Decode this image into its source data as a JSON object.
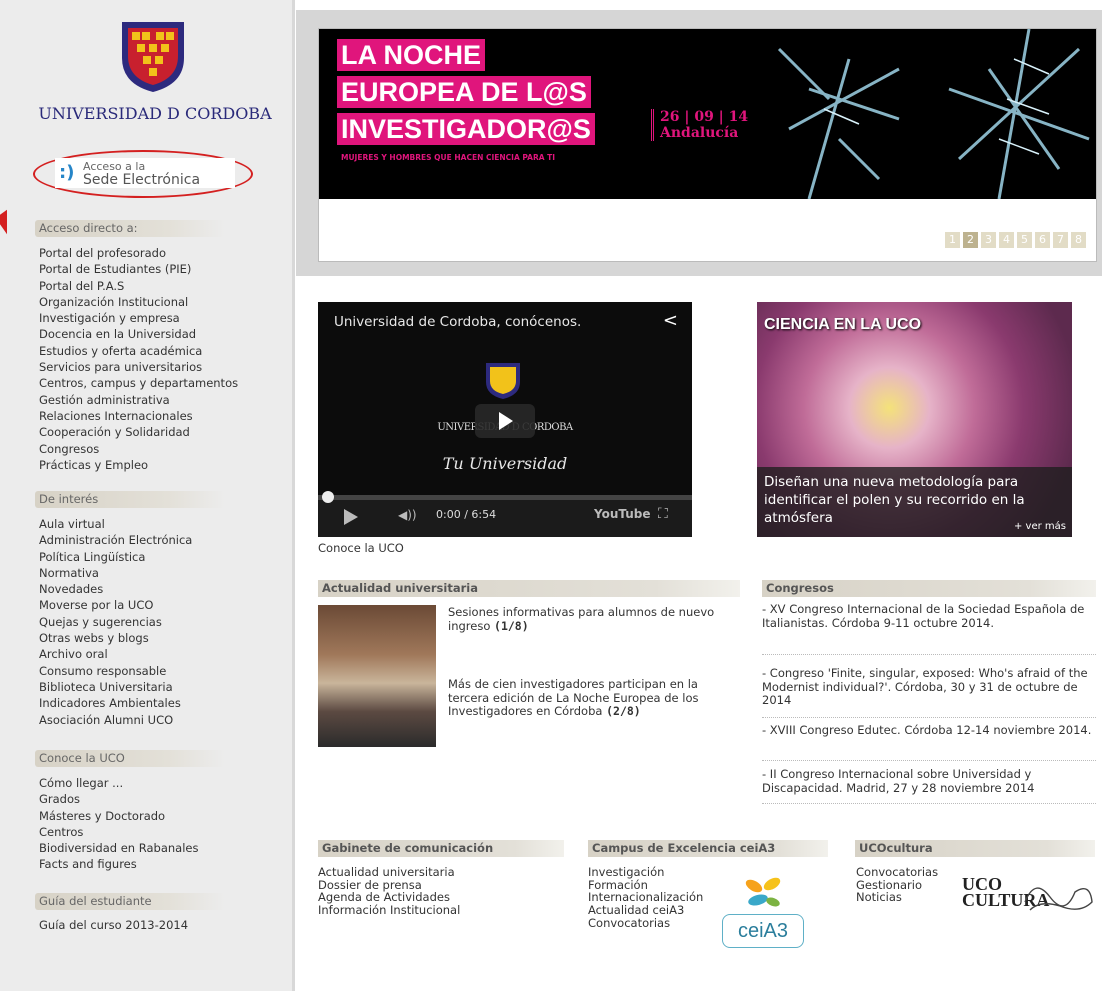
{
  "brand": {
    "university_name": "UNIVERSIDAD D CORDOBA",
    "sede_line1": "Acceso a la",
    "sede_line2": "Sede Electrónica",
    "accent_red": "#d42020",
    "banner_pink": "#e0157c"
  },
  "sidebar": {
    "sections": [
      {
        "title": "Acceso directo a:",
        "items": [
          "Portal del profesorado",
          "Portal de Estudiantes (PIE)",
          "Portal del P.A.S",
          "Organización Institucional",
          "Investigación y empresa",
          "Docencia en la Universidad",
          "Estudios y oferta académica",
          "Servicios para universitarios",
          "Centros, campus y departamentos",
          "Gestión administrativa",
          "Relaciones Internacionales",
          "Cooperación y Solidaridad",
          "Congresos",
          "Prácticas y Empleo"
        ]
      },
      {
        "title": "De interés",
        "items": [
          "Aula virtual",
          "Administración Electrónica",
          "Política Lingüística",
          "Normativa",
          "Novedades",
          "Moverse por la UCO",
          "Quejas y sugerencias",
          "Otras webs y blogs",
          "Archivo oral",
          "Consumo responsable",
          "Biblioteca Universitaria",
          "Indicadores Ambientales",
          "Asociación Alumni UCO"
        ]
      },
      {
        "title": "Conoce la UCO",
        "items": [
          "Cómo llegar ...",
          "Grados",
          "Másteres y Doctorado",
          "Centros",
          "Biodiversidad en Rabanales",
          "Facts and figures"
        ]
      },
      {
        "title": "Guía del estudiante",
        "items": [
          "Guía del curso 2013-2014"
        ]
      }
    ]
  },
  "banner": {
    "line1": "LA NOCHE",
    "line2": "EUROPEA DE L@S",
    "line3": "INVESTIGADOR@S",
    "date": "26 | 09 | 14",
    "region": "Andalucía",
    "tagline": "MUJERES Y HOMBRES QUE HACEN CIENCIA PARA TI",
    "pages": [
      "1",
      "2",
      "3",
      "4",
      "5",
      "6",
      "7",
      "8"
    ],
    "active_page": "2"
  },
  "video": {
    "title": "Universidad de Cordoba, conócenos.",
    "university": "UNIVERSIDAD D CORDOBA",
    "tagline": "Tu Universidad",
    "time": "0:00 / 6:54",
    "provider": "YouTube",
    "caption": "Conoce la UCO",
    "progress": 0
  },
  "ciencia": {
    "title": "CIENCIA EN LA UCO",
    "text": "Diseñan una nueva metodología para identificar el polen y su recorrido en la atmósfera",
    "more": "+ ver más"
  },
  "actualidad": {
    "title": "Actualidad universitaria",
    "items": [
      {
        "text": "Sesiones informativas para alumnos de nuevo ingreso",
        "counter": "(1/8)"
      },
      {
        "text": "Más de cien investigadores participan en la tercera edición de La Noche Europea de los Investigadores en Córdoba",
        "counter": "(2/8)"
      }
    ]
  },
  "congresos": {
    "title": "Congresos",
    "items": [
      "- XV Congreso Internacional de la Sociedad Española de Italianistas. Córdoba 9-11 octubre 2014.",
      "- Congreso 'Finite, singular, exposed: Who's afraid of the Modernist individual?'. Córdoba, 30 y 31 de octubre de 2014",
      "- XVIII Congreso Edutec. Córdoba 12-14 noviembre 2014.",
      "- II Congreso Internacional sobre Universidad y Discapacidad. Madrid, 27 y 28 noviembre 2014"
    ]
  },
  "gabinete": {
    "title": "Gabinete de comunicación",
    "items": [
      "Actualidad universitaria",
      "Dossier de prensa",
      "Agenda de Actividades",
      "Información Institucional"
    ]
  },
  "campus": {
    "title": "Campus de Excelencia ceiA3",
    "items": [
      "Investigación",
      "Formación",
      "Internacionalización",
      "Actualidad ceiA3",
      "Convocatorias"
    ],
    "logo_text": "ceiA3"
  },
  "ucocultura": {
    "title": "UCOcultura",
    "items": [
      "Convocatorias",
      "Gestionario",
      "Noticias"
    ],
    "logo_line1": "UCO",
    "logo_line2": "CULTURA"
  }
}
